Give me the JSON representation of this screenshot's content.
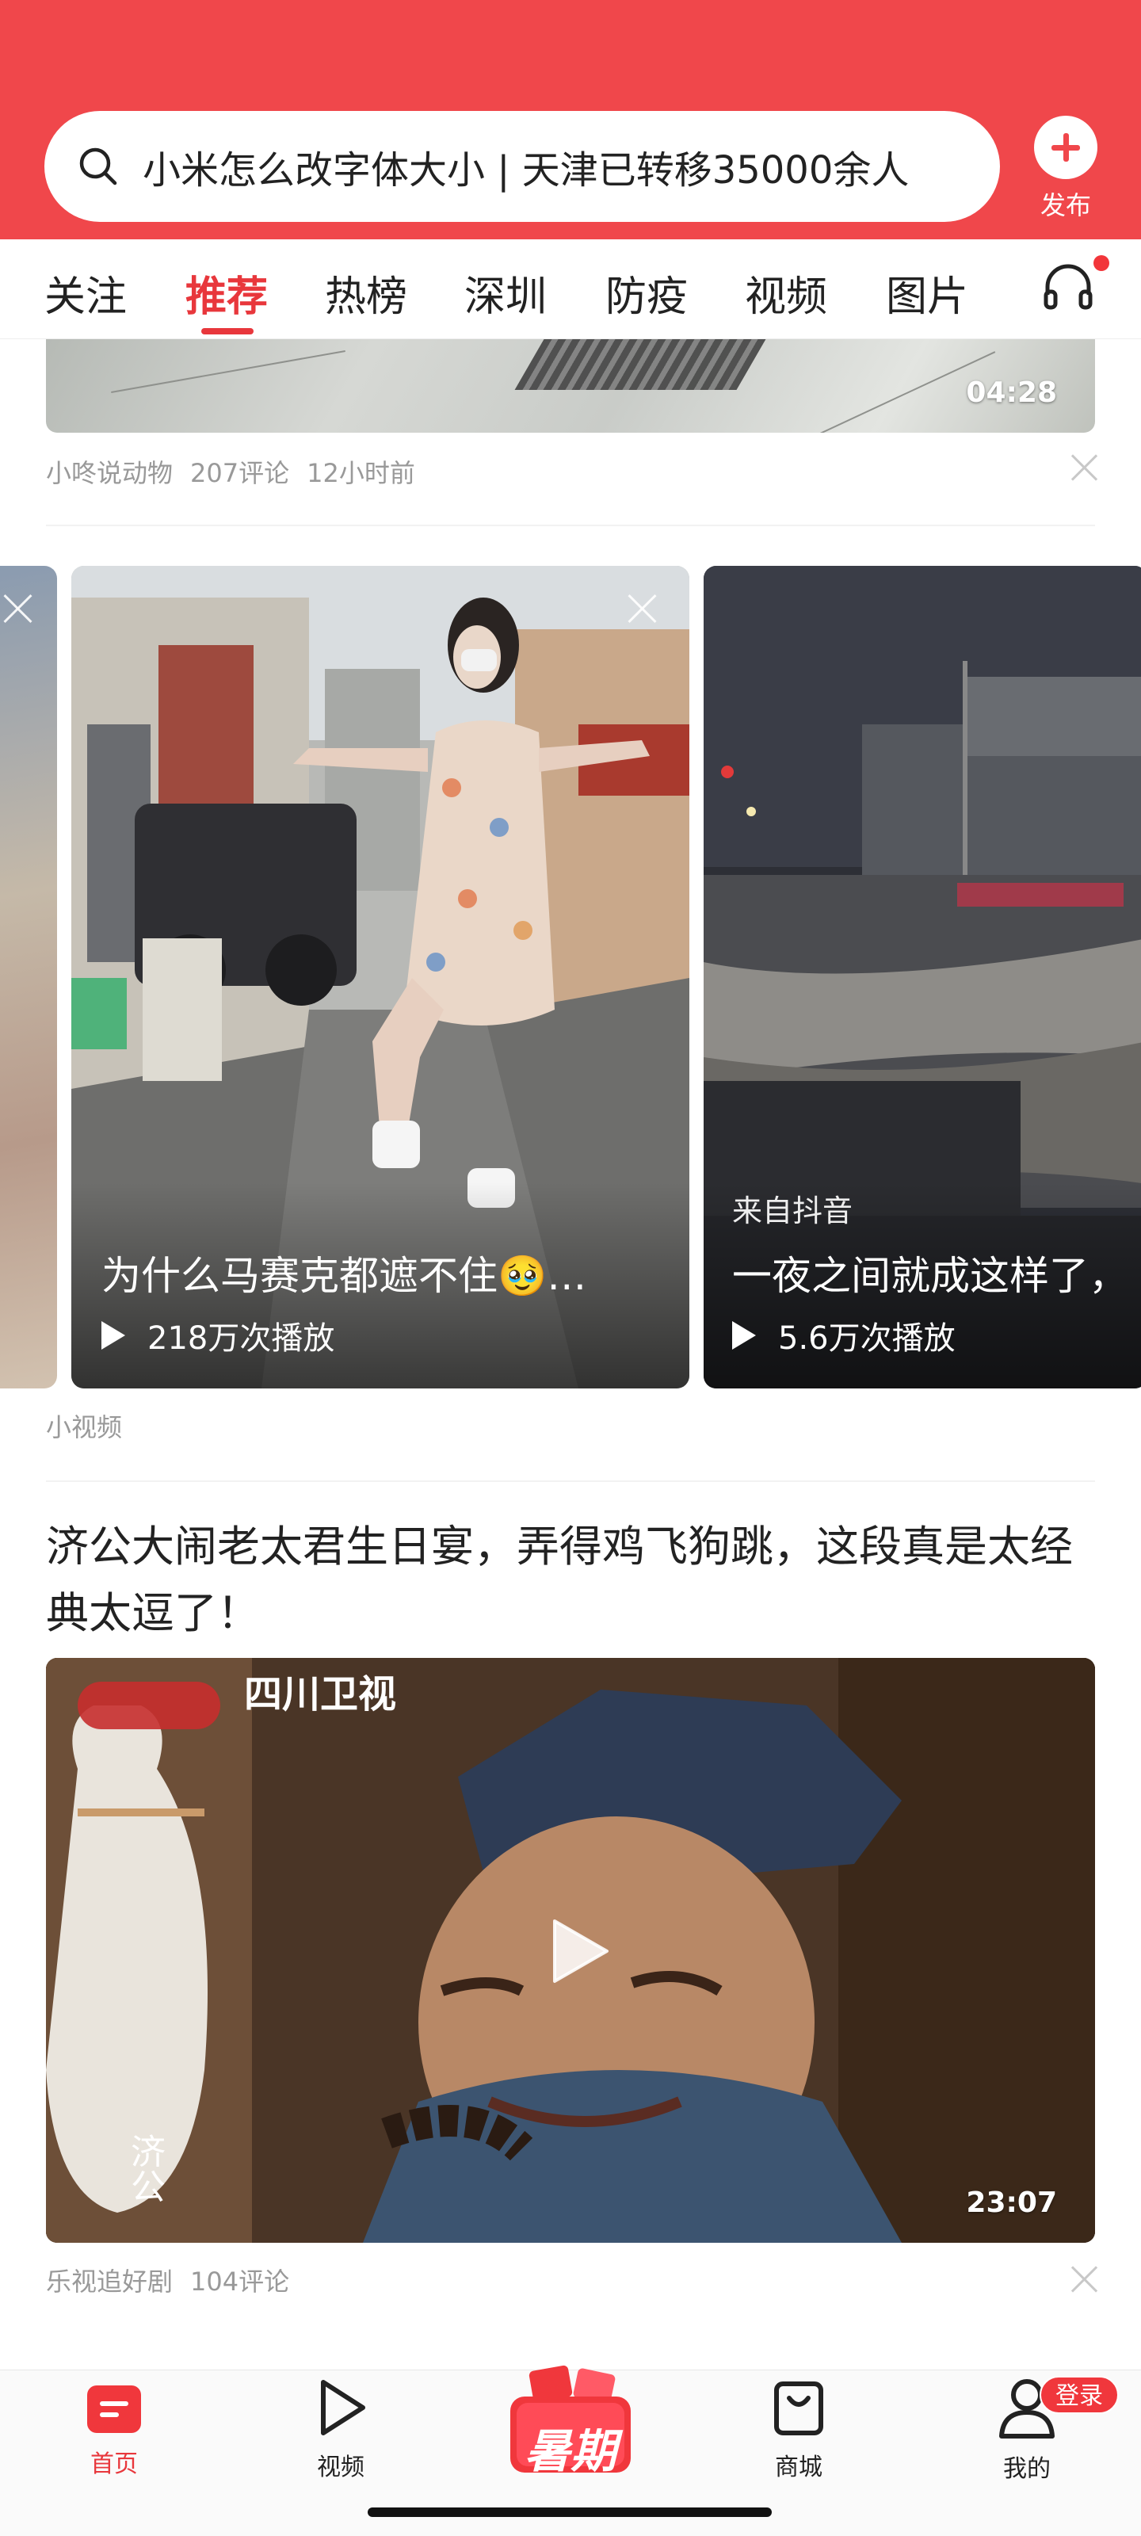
{
  "search": {
    "query": "小米怎么改字体大小 | 天津已转移35000余人"
  },
  "header": {
    "publish_label": "发布"
  },
  "tabs": [
    {
      "label": "关注"
    },
    {
      "label": "推荐"
    },
    {
      "label": "热榜"
    },
    {
      "label": "深圳"
    },
    {
      "label": "防疫"
    },
    {
      "label": "视频"
    },
    {
      "label": "图片"
    }
  ],
  "feed": {
    "top_video": {
      "duration": "04:28",
      "source": "小咚说动物",
      "comments": "207评论",
      "time": "12小时前"
    },
    "small_videos": {
      "section_label": "小视频",
      "cards": [
        {
          "title": "为什么马赛克都遮不住🥹…",
          "plays": "218万次播放"
        },
        {
          "source": "来自抖音",
          "title": "一夜之间就成这样了，",
          "plays": "5.6万次播放"
        }
      ]
    },
    "article": {
      "title": "济公大闹老太君生日宴，弄得鸡飞狗跳，这段真是太经典太逗了！",
      "duration": "23:07",
      "source": "乐视追好剧",
      "comments": "104评论",
      "watermark": "四川卫视",
      "caption": "济公"
    }
  },
  "bottom_nav": {
    "items": [
      {
        "label": "首页",
        "icon": "home-icon"
      },
      {
        "label": "视频",
        "icon": "play-icon"
      },
      {
        "label": "暑期",
        "icon": "summer-promo-icon"
      },
      {
        "label": "商城",
        "icon": "shopping-bag-icon"
      },
      {
        "label": "我的",
        "icon": "profile-icon"
      }
    ],
    "login_badge": "登录"
  },
  "colors": {
    "brand_red": "#f0474b",
    "active_red": "#e8373c"
  }
}
